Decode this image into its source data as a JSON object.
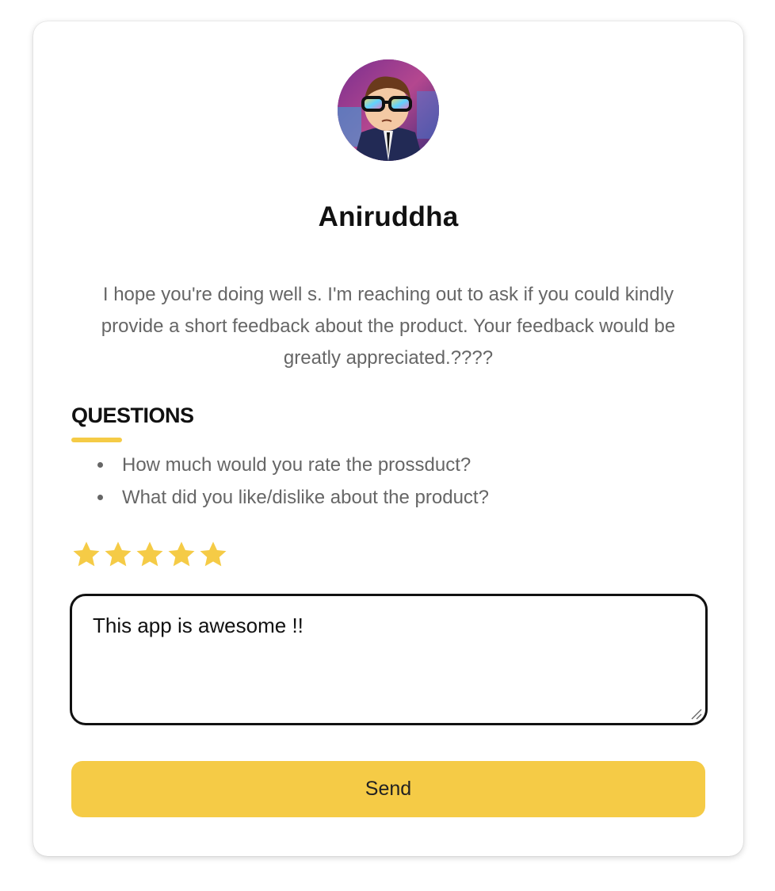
{
  "profile": {
    "name": "Aniruddha",
    "avatar_icon": "user-avatar"
  },
  "intro_text": "I hope you're doing well s. I'm reaching out to ask if you could kindly provide a short feedback about the product. Your feedback would be greatly appreciated.????",
  "questions": {
    "title": "QUESTIONS",
    "items": [
      "How much would you rate the prossduct?",
      "What did you like/dislike about the product?"
    ]
  },
  "rating": {
    "value": 5,
    "max": 5,
    "icon": "star-icon"
  },
  "feedback": {
    "value": "This app is awesome !!",
    "placeholder": ""
  },
  "send_button": {
    "label": "Send"
  },
  "colors": {
    "accent": "#f5cb46",
    "text_dark": "#111111",
    "text_muted": "#666666"
  }
}
